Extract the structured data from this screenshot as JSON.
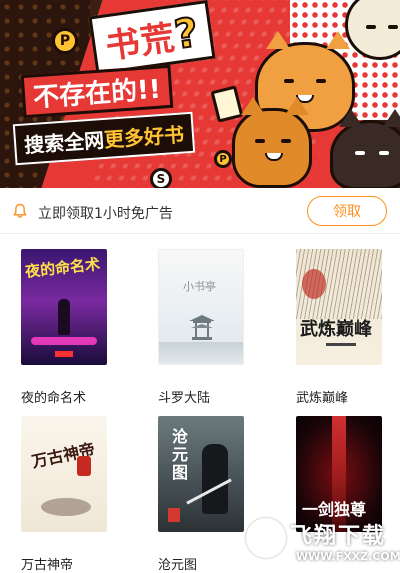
{
  "banner": {
    "headline": "书荒",
    "question": "?",
    "subline": "不存在的!!",
    "tagline_prefix": "搜索全网",
    "tagline_highlight": "更多好书"
  },
  "ad_bar": {
    "text": "立即领取1小时免广告",
    "button_label": "领取",
    "accent_color": "#ff8f1f"
  },
  "books": [
    {
      "title": "夜的命名术",
      "cover_title": "夜的命名术"
    },
    {
      "title": "斗罗大陆",
      "cover_title": "小书亭"
    },
    {
      "title": "武炼巅峰",
      "cover_title": "武炼巅峰"
    },
    {
      "title": "万古神帝",
      "cover_title": "万古神帝"
    },
    {
      "title": "沧元图",
      "cover_title": "沧元图"
    },
    {
      "title": "",
      "cover_title": "一剑独尊"
    }
  ],
  "watermark": {
    "brand": "飞翔下载",
    "url": "WWW.FXXZ.COM"
  }
}
